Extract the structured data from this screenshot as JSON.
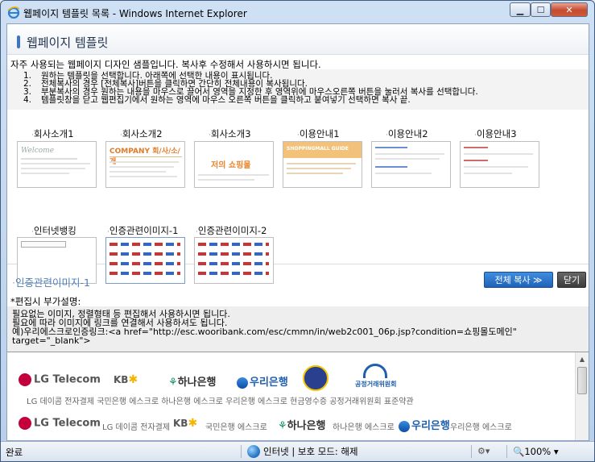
{
  "window": {
    "title": "웹페이지 템플릿 목록 - Windows Internet Explorer",
    "min_glyph": "▁",
    "max_glyph": "☐",
    "close_glyph": "✕"
  },
  "header": {
    "title": "웹페이지 템플릿"
  },
  "intro": "자주 사용되는 웹페이지 디자인 샘플입니다. 복사후 수정해서 사용하시면 됩니다.",
  "steps": [
    {
      "num": "1.",
      "text": "원하는 템플릿을 선택합니다. 아래쪽에 선택한 내용이 표시됩니다."
    },
    {
      "num": "2.",
      "text": "전체복사의 경우 [전체복사]버튼을 클릭하면 간단히 전체내용이 복사됩니다."
    },
    {
      "num": "3.",
      "text": "부분복사의 경우 원하는 내용을 마우스로 끌어서 영역을 지정한 후 영역위에 마우스오른쪽 버튼을 눌러서 복사를 선택합니다."
    },
    {
      "num": "4.",
      "text": "템플릿창을 닫고 웹편집기에서 원하는 영역에 마우스 오른쪽 버튼을 클릭하고 붙여넣기 선택하면 복사 끝."
    }
  ],
  "templates": [
    {
      "label": "회사소개1",
      "thumb_text": "Welcome"
    },
    {
      "label": "회사소개2",
      "thumb_text": "COMPANY 회/사/소/개"
    },
    {
      "label": "회사소개3",
      "thumb_text": "저의 쇼핑몰"
    },
    {
      "label": "이용안내1",
      "thumb_text": "SHOPPINGMALL GUIDE"
    },
    {
      "label": "이용안내2",
      "thumb_text": ""
    },
    {
      "label": "이용안내3",
      "thumb_text": ""
    },
    {
      "label": "인터넷뱅킹",
      "thumb_text": ""
    },
    {
      "label": "인증관련이미지-1",
      "thumb_text": ""
    },
    {
      "label": "인증관련이미지-2",
      "thumb_text": ""
    }
  ],
  "selected": {
    "title": "인증관련이미지-1"
  },
  "buttons": {
    "copy_all": "전체 복사",
    "copy_all_glyph": "≫",
    "close": "닫기"
  },
  "memo": {
    "label": "*편집시 부가설명:",
    "lines": [
      "필요없는 이미지, 정렬형태 등 편집해서 사용하시면 됩니다.",
      "필요에 따라 이미지에 링크를 연결해서 사용하셔도 됩니다.",
      "예)우리에스크로인증링크:<a href=\"http://esc.wooribank.com/esc/cmmn/in/web2c001_06p.jsp?condition=쇼핑몰도메인\"",
      "target=\"_blank\">"
    ]
  },
  "preview": {
    "row1_logos": [
      "LG Telecom",
      "KB",
      "하나은행",
      "우리은행",
      "공정거래위원회"
    ],
    "row1_caption": "LG 데이콤 전자결제   국민은행 에스크로 하나은행 에스크로 우리은행 에스크로  현금영수증  공정거래위원회 표준약관",
    "row2_items": [
      "LG Telecom",
      "LG 데이콤 전자결제",
      "KB",
      "국민은행 에스크로",
      "하나은행",
      "하나은행 에스크로",
      "우리은행",
      "우리은행 에스크로"
    ]
  },
  "status": {
    "text": "완료",
    "zone": "인터넷 | 보호 모드: 해제",
    "zoom": "100%"
  },
  "colors": {
    "accent": "#3a76c8",
    "selected_title": "#4e7fb8",
    "copy_button": "#1f63b8"
  }
}
